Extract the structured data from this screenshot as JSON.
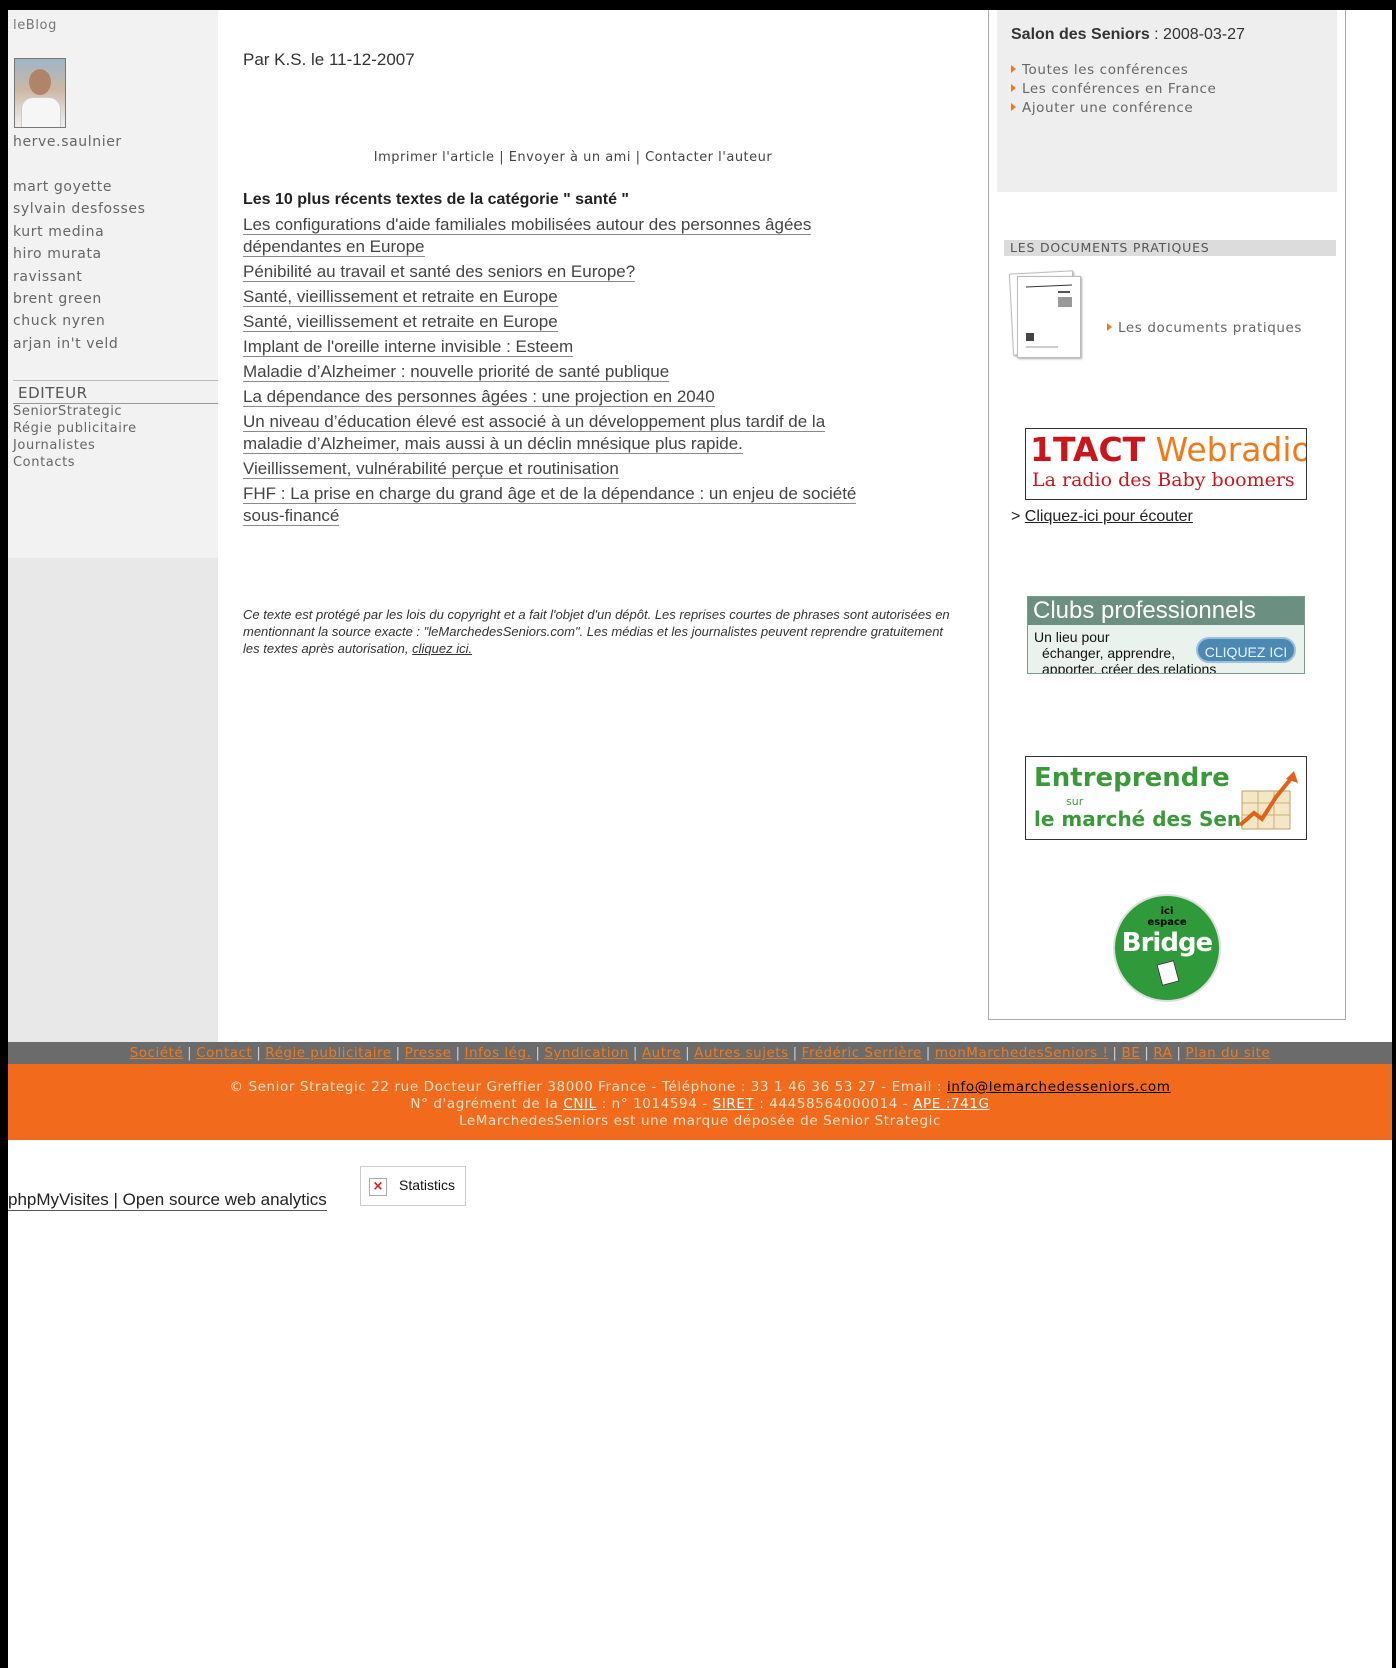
{
  "sidebar": {
    "brand": "leBlog",
    "author": "herve.saulnier",
    "people": [
      "mart goyette",
      "sylvain desfosses",
      "kurt medina",
      "hiro murata",
      "ravissant",
      "brent green",
      "chuck nyren",
      "arjan in't veld"
    ],
    "editor_heading": "EDITEUR",
    "editor_links": [
      "SeniorStrategic",
      "Régie publicitaire",
      "Journalistes",
      "Contacts"
    ]
  },
  "article": {
    "byline": "Par K.S. le 11-12-2007",
    "tools": {
      "print": "Imprimer l'article",
      "send": "Envoyer à un ami",
      "contact": "Contacter l'auteur",
      "separator": " | "
    },
    "recent_title": "Les 10 plus récents textes de la catégorie \" santé \"",
    "recent": [
      "Les configurations d'aide familiales mobilisées autour des personnes âgées dépendantes en Europe",
      "Pénibilité au travail et santé des seniors en Europe?",
      "Santé, vieillissement et retraite en Europe",
      "Santé, vieillissement et retraite en Europe",
      "Implant de l'oreille interne invisible : Esteem",
      "Maladie d’Alzheimer : nouvelle priorité de santé publique",
      "La dépendance des personnes âgées : une projection en 2040",
      "Un niveau d’éducation élevé est associé à un développement plus tardif de la maladie d’Alzheimer, mais aussi à un déclin mnésique plus rapide.",
      "Vieillissement, vulnérabilité perçue et routinisation",
      "FHF : La prise en charge du grand âge et de la dépendance : un enjeu de société sous-financé"
    ],
    "copyright_text": "Ce texte est protégé par les lois du copyright et a fait l'objet d'un dépôt. Les reprises courtes de phrases sont autorisées en mentionnant la source exacte : \"leMarchedesSeniors.com\". Les médias et les journalistes peuvent reprendre gratuitement les textes après autorisation,",
    "copyright_link": "cliquez ici."
  },
  "right": {
    "salon_title": "Salon des Seniors",
    "salon_date": " : 2008-03-27",
    "salon_links": [
      "Toutes les conférences",
      "Les conférences en France",
      "Ajouter une conférence"
    ],
    "docs_heading": "LES DOCUMENTS PRATIQUES",
    "docs_link": "Les documents pratiques",
    "webradio": {
      "brand_a": "1TACT",
      "brand_b": " Webradio",
      "tagline": "La radio des Baby boomers"
    },
    "listen_prefix": "> ",
    "listen_link": "Cliquez-ici pour écouter",
    "clubs": {
      "title": "Clubs professionnels",
      "line1": "Un lieu pour",
      "line2": "échanger, apprendre,",
      "line3": "apporter, créer des relations",
      "button": "CLIQUEZ ICI"
    },
    "entreprendre": {
      "line1": "Entreprendre",
      "line2": "sur",
      "line3": "le marché des Seniors"
    },
    "bridge": {
      "small1": "ici",
      "small2": "espace",
      "word": "Bridge"
    }
  },
  "footer": {
    "nav": [
      "Société",
      "Contact",
      "Régie publicitaire",
      "Presse",
      "Infos lég.",
      "Syndication",
      "Autre",
      "Autres sujets",
      "Frédéric Serrière",
      "monMarchedesSeniors !",
      "BE",
      "RA",
      "Plan du site"
    ],
    "line1_text": "© Senior Strategic 22 rue Docteur Greffier 38000 France - Téléphone : 33 1 46 36 53 27 - Email : ",
    "email": "info@lemarchedesseniors.com",
    "line2_a": "N° d'agrément de la ",
    "cnil": "CNIL",
    "line2_b": " : n° 1014594 - ",
    "siret": "SIRET",
    "line2_c": " : 44458564000014 - ",
    "ape": "APE :741G",
    "line3": "LeMarchedesSeniors est une marque déposée de Senior Strategic"
  },
  "analytics": {
    "link": "phpMyVisites | Open source web analytics",
    "image_alt": "Statistics"
  },
  "colors": {
    "accent_orange": "#f26a1b",
    "nav_gray": "#6b6b6b",
    "sidebar_gray": "#e8e8e8"
  }
}
